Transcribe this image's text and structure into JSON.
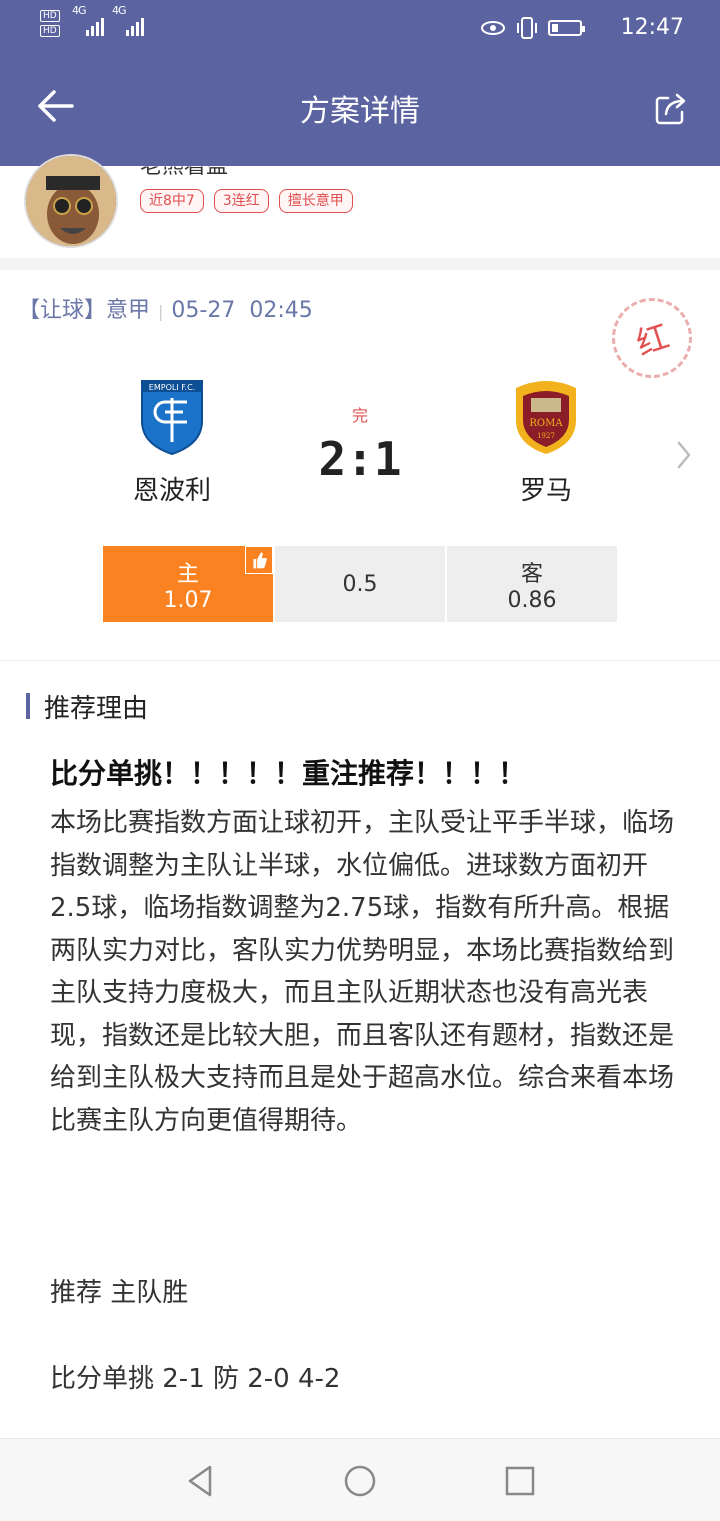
{
  "status_bar": {
    "hd1": "HD",
    "hd2": "HD",
    "signal1": "4G",
    "signal2": "4G",
    "time": "12:47",
    "battery_level": 0.2
  },
  "header": {
    "title": "方案详情",
    "back_icon": "arrow-left-icon",
    "share_icon": "share-icon"
  },
  "author": {
    "name": "老熊看盘",
    "tags": [
      "近8中7",
      "3连红",
      "擅长意甲"
    ]
  },
  "match": {
    "type": "【让球】",
    "league": "意甲",
    "date": "05-27",
    "time": "02:45",
    "result_stamp": "红",
    "status": "完",
    "score": "2:1",
    "home_team": "恩波利",
    "away_team": "罗马",
    "home_logo_text": "EMPOLI F.C.",
    "away_logo_text": "ROMA",
    "away_logo_year": "1927"
  },
  "odds": {
    "home_label": "主",
    "home_value": "1.07",
    "line": "0.5",
    "away_label": "客",
    "away_value": "0.86",
    "selected": "home"
  },
  "reason": {
    "section_title": "推荐理由",
    "headline": "比分单挑！！！！！重注推荐！！！！",
    "paragraph": "本场比赛指数方面让球初开，主队受让平手半球，临场指数调整为主队让半球，水位偏低。进球数方面初开2.5球，临场指数调整为2.75球，指数有所升高。根据两队实力对比，客队实力优势明显，本场比赛指数给到主队支持力度极大，而且主队近期状态也没有高光表现，指数还是比较大胆，而且客队还有题材，指数还是给到主队极大支持而且是处于超高水位。综合来看本场比赛主队方向更值得期待。",
    "recommend": "推荐   主队胜",
    "score_pick": "比分单挑  2-1  防  2-0   4-2"
  },
  "navbar": {
    "back_icon": "triangle-back-icon",
    "home_icon": "circle-home-icon",
    "recents_icon": "square-recents-icon"
  }
}
